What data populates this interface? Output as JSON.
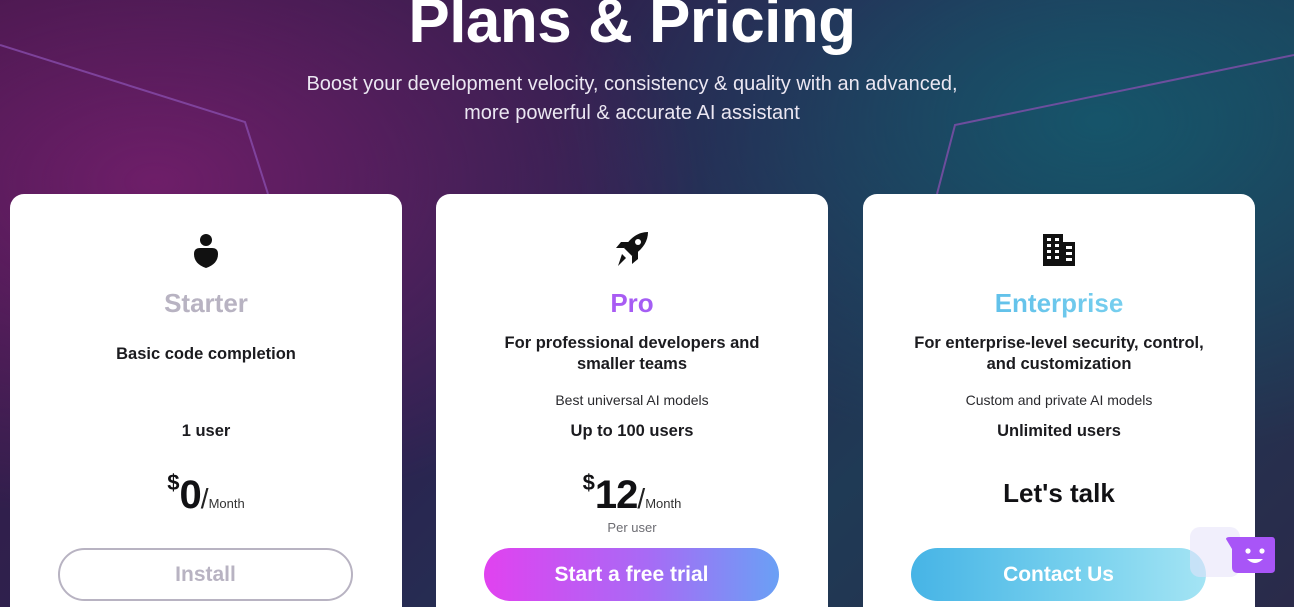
{
  "hero": {
    "title": "Plans & Pricing",
    "subtitle": "Boost your development velocity, consistency & quality with an advanced, more powerful & accurate AI assistant"
  },
  "plans": [
    {
      "name": "Starter",
      "icon": "user-icon",
      "description": "Basic code completion",
      "models": "",
      "users": "1 user",
      "currency": "$",
      "amount": "0",
      "slash": "/",
      "period": "Month",
      "cta": "Install"
    },
    {
      "name": "Pro",
      "icon": "rocket-icon",
      "description": "For professional developers and smaller teams",
      "models": "Best universal AI models",
      "users": "Up to 100 users",
      "currency": "$",
      "amount": "12",
      "slash": "/",
      "period": "Month",
      "price_note": "Per user",
      "cta": "Start a free trial"
    },
    {
      "name": "Enterprise",
      "icon": "building-icon",
      "description": "For enterprise-level security, control, and customization",
      "models": "Custom and private AI models",
      "users": "Unlimited users",
      "price_text": "Let's talk",
      "cta": "Contact Us"
    }
  ],
  "colors": {
    "starter_accent": "#b8b3c2",
    "pro_gradient": [
      "#e142f0",
      "#6aa0f5"
    ],
    "enterprise_gradient": [
      "#46b4e6",
      "#a4e4f4"
    ],
    "chat_widget": "#a855f7"
  },
  "chat_widget": {
    "icon": "chat-bot-icon"
  }
}
